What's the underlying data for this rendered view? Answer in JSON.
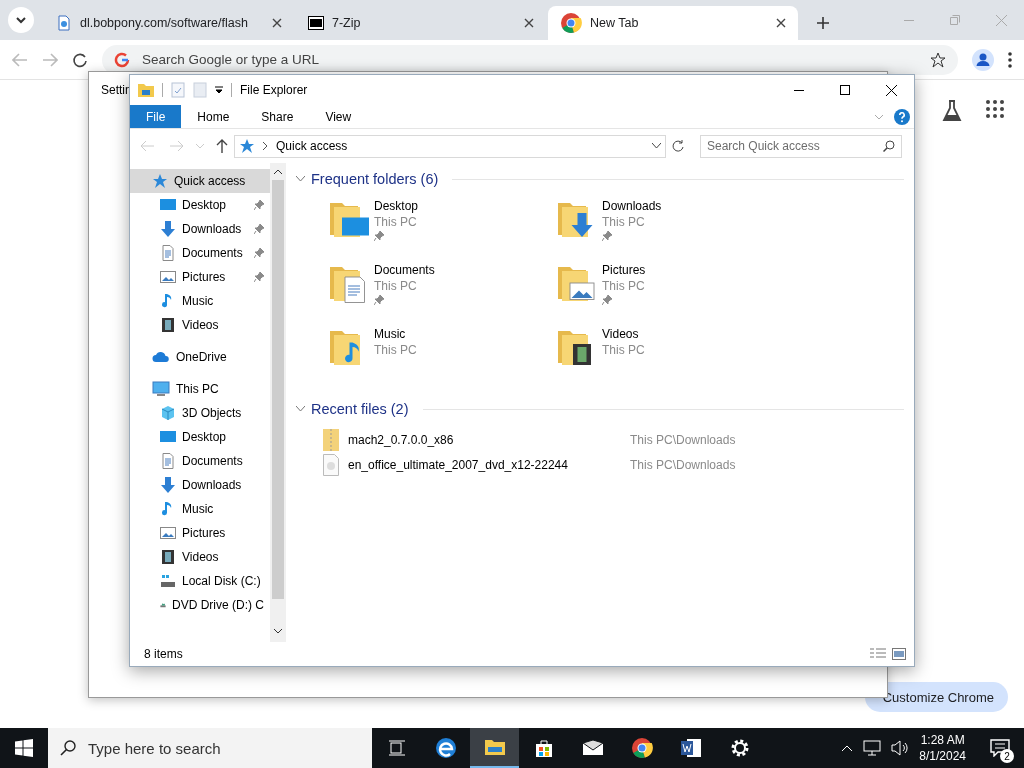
{
  "browser": {
    "tabs": [
      {
        "title": "dl.bobpony.com/software/flash",
        "kind": "page",
        "selected": false
      },
      {
        "title": "7-Zip",
        "kind": "zip",
        "selected": false
      },
      {
        "title": "New Tab",
        "kind": "chrome",
        "selected": true
      }
    ],
    "address_placeholder": "Search Google or type a URL",
    "customize_button": "Customize Chrome"
  },
  "settings_window": {
    "title": "Settin"
  },
  "explorer": {
    "title": "File Explorer",
    "ribbon_tabs": [
      {
        "label": "File",
        "selected": true
      },
      {
        "label": "Home",
        "selected": false
      },
      {
        "label": "Share",
        "selected": false
      },
      {
        "label": "View",
        "selected": false
      }
    ],
    "address": "Quick access",
    "search": {
      "placeholder": "Search Quick access"
    },
    "nav": [
      {
        "label": "Quick access",
        "kind": "quick",
        "selected": true,
        "children": [
          {
            "label": "Desktop",
            "kind": "desktop",
            "pinned": true
          },
          {
            "label": "Downloads",
            "kind": "downloads",
            "pinned": true
          },
          {
            "label": "Documents",
            "kind": "documents",
            "pinned": true
          },
          {
            "label": "Pictures",
            "kind": "pictures",
            "pinned": true
          },
          {
            "label": "Music",
            "kind": "music",
            "pinned": false
          },
          {
            "label": "Videos",
            "kind": "videos",
            "pinned": false
          }
        ]
      },
      {
        "label": "OneDrive",
        "kind": "onedrive",
        "selected": false
      },
      {
        "label": "This PC",
        "kind": "pc",
        "selected": false,
        "children": [
          {
            "label": "3D Objects",
            "kind": "cube",
            "pinned": false
          },
          {
            "label": "Desktop",
            "kind": "desktop",
            "pinned": false
          },
          {
            "label": "Documents",
            "kind": "documents",
            "pinned": false
          },
          {
            "label": "Downloads",
            "kind": "downloads",
            "pinned": false
          },
          {
            "label": "Music",
            "kind": "music",
            "pinned": false
          },
          {
            "label": "Pictures",
            "kind": "pictures",
            "pinned": false
          },
          {
            "label": "Videos",
            "kind": "videos",
            "pinned": false
          },
          {
            "label": "Local Disk (C:)",
            "kind": "disk",
            "pinned": false
          },
          {
            "label": "DVD Drive (D:) C",
            "kind": "dvd",
            "pinned": false
          }
        ]
      }
    ],
    "frequent": {
      "title": "Frequent folders (6)",
      "items": [
        {
          "name": "Desktop",
          "location": "This PC",
          "kind": "desktop",
          "pinned": true
        },
        {
          "name": "Downloads",
          "location": "This PC",
          "kind": "downloads",
          "pinned": true
        },
        {
          "name": "Documents",
          "location": "This PC",
          "kind": "documents",
          "pinned": true
        },
        {
          "name": "Pictures",
          "location": "This PC",
          "kind": "pictures",
          "pinned": true
        },
        {
          "name": "Music",
          "location": "This PC",
          "kind": "music",
          "pinned": false
        },
        {
          "name": "Videos",
          "location": "This PC",
          "kind": "videos",
          "pinned": false
        }
      ]
    },
    "recent": {
      "title": "Recent files (2)",
      "items": [
        {
          "name": "mach2_0.7.0.0_x86",
          "path": "This PC\\Downloads",
          "kind": "zip"
        },
        {
          "name": "en_office_ultimate_2007_dvd_x12-22244",
          "path": "This PC\\Downloads",
          "kind": "disc"
        }
      ]
    },
    "status": "8 items"
  },
  "taskbar": {
    "search_placeholder": "Type here to search",
    "apps": [
      {
        "kind": "taskview",
        "active": false
      },
      {
        "kind": "edge",
        "active": false
      },
      {
        "kind": "explorer",
        "active": true
      },
      {
        "kind": "store",
        "active": false
      },
      {
        "kind": "mail",
        "active": false
      },
      {
        "kind": "chrome",
        "active": false
      },
      {
        "kind": "word",
        "active": false
      },
      {
        "kind": "settings",
        "active": false
      }
    ],
    "time": "1:28 AM",
    "date": "8/1/2024",
    "notifications": "2"
  }
}
